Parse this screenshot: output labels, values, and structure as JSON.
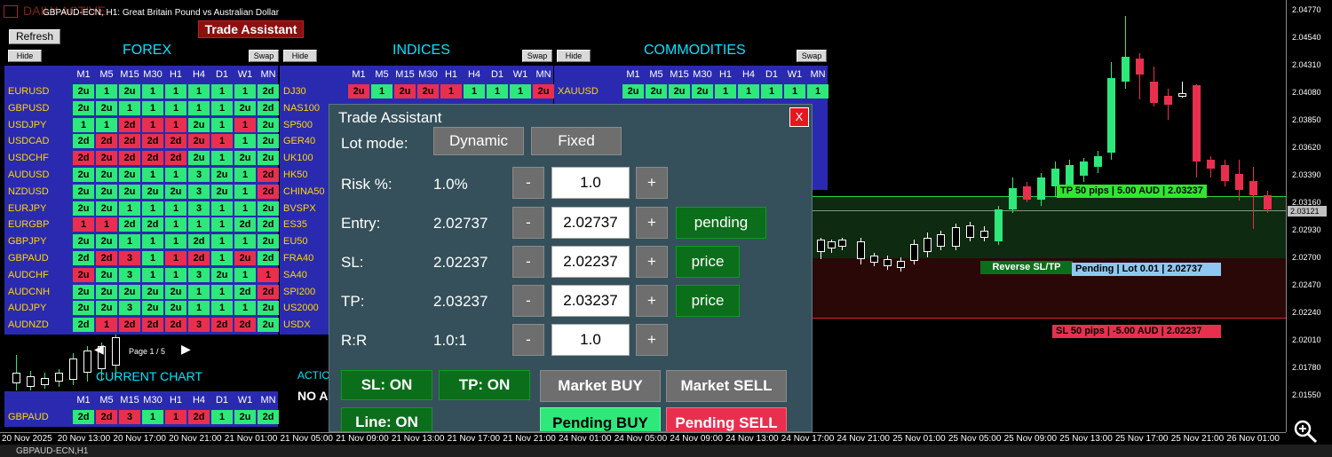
{
  "window": {
    "symbol_title": "GBPAUD-ECN, H1:  Great Britain Pound vs Australian Dollar",
    "ghost_text": "DAILY ACTIVE"
  },
  "toolbar": {
    "refresh": "Refresh",
    "badge": "Trade Assistant"
  },
  "sections": {
    "forex": "FOREX",
    "indices": "INDICES",
    "commodities": "COMMODITIES",
    "current_chart": "CURRENT CHART",
    "action": "ACTIO",
    "no_action": "NO A"
  },
  "hide_label": "Hide",
  "swap_label": "Swap",
  "timeframes": [
    "M1",
    "M5",
    "M15",
    "M30",
    "H1",
    "H4",
    "D1",
    "W1",
    "MN"
  ],
  "forex_rows": [
    {
      "symbol": "EURUSD",
      "cells": [
        [
          "2u",
          "g"
        ],
        [
          "1",
          "g"
        ],
        [
          "2u",
          "g"
        ],
        [
          "1",
          "g"
        ],
        [
          "1",
          "g"
        ],
        [
          "1",
          "g"
        ],
        [
          "1",
          "g"
        ],
        [
          "1",
          "g"
        ],
        [
          "2d",
          "g"
        ]
      ]
    },
    {
      "symbol": "GBPUSD",
      "cells": [
        [
          "2u",
          "g"
        ],
        [
          "2u",
          "g"
        ],
        [
          "1",
          "g"
        ],
        [
          "1",
          "g"
        ],
        [
          "1",
          "g"
        ],
        [
          "1",
          "g"
        ],
        [
          "1",
          "g"
        ],
        [
          "2u",
          "g"
        ],
        [
          "2d",
          "g"
        ]
      ]
    },
    {
      "symbol": "USDJPY",
      "cells": [
        [
          "1",
          "g"
        ],
        [
          "1",
          "g"
        ],
        [
          "2d",
          "r"
        ],
        [
          "1",
          "r"
        ],
        [
          "1",
          "r"
        ],
        [
          "2u",
          "g"
        ],
        [
          "1",
          "g"
        ],
        [
          "1",
          "r"
        ],
        [
          "2u",
          "g"
        ]
      ]
    },
    {
      "symbol": "USDCAD",
      "cells": [
        [
          "2d",
          "g"
        ],
        [
          "2d",
          "r"
        ],
        [
          "2d",
          "r"
        ],
        [
          "2d",
          "r"
        ],
        [
          "2d",
          "r"
        ],
        [
          "2u",
          "r"
        ],
        [
          "1",
          "r"
        ],
        [
          "1",
          "g"
        ],
        [
          "2u",
          "g"
        ]
      ]
    },
    {
      "symbol": "USDCHF",
      "cells": [
        [
          "2d",
          "r"
        ],
        [
          "2u",
          "r"
        ],
        [
          "2d",
          "r"
        ],
        [
          "2d",
          "r"
        ],
        [
          "2d",
          "r"
        ],
        [
          "2u",
          "g"
        ],
        [
          "1",
          "g"
        ],
        [
          "2u",
          "g"
        ],
        [
          "2u",
          "g"
        ]
      ]
    },
    {
      "symbol": "AUDUSD",
      "cells": [
        [
          "2u",
          "g"
        ],
        [
          "2u",
          "g"
        ],
        [
          "2u",
          "g"
        ],
        [
          "1",
          "g"
        ],
        [
          "1",
          "g"
        ],
        [
          "3",
          "g"
        ],
        [
          "2u",
          "g"
        ],
        [
          "1",
          "g"
        ],
        [
          "2d",
          "r"
        ]
      ]
    },
    {
      "symbol": "NZDUSD",
      "cells": [
        [
          "2u",
          "g"
        ],
        [
          "2u",
          "g"
        ],
        [
          "2u",
          "g"
        ],
        [
          "2u",
          "g"
        ],
        [
          "2u",
          "g"
        ],
        [
          "3",
          "g"
        ],
        [
          "2u",
          "g"
        ],
        [
          "1",
          "g"
        ],
        [
          "2d",
          "r"
        ]
      ]
    },
    {
      "symbol": "EURJPY",
      "cells": [
        [
          "2u",
          "g"
        ],
        [
          "2u",
          "g"
        ],
        [
          "1",
          "g"
        ],
        [
          "1",
          "g"
        ],
        [
          "1",
          "g"
        ],
        [
          "3",
          "g"
        ],
        [
          "1",
          "g"
        ],
        [
          "1",
          "g"
        ],
        [
          "2u",
          "g"
        ]
      ]
    },
    {
      "symbol": "EURGBP",
      "cells": [
        [
          "1",
          "r"
        ],
        [
          "1",
          "r"
        ],
        [
          "2d",
          "g"
        ],
        [
          "2d",
          "g"
        ],
        [
          "1",
          "g"
        ],
        [
          "1",
          "g"
        ],
        [
          "1",
          "g"
        ],
        [
          "2d",
          "g"
        ],
        [
          "2d",
          "g"
        ]
      ]
    },
    {
      "symbol": "GBPJPY",
      "cells": [
        [
          "2u",
          "g"
        ],
        [
          "2u",
          "g"
        ],
        [
          "1",
          "g"
        ],
        [
          "1",
          "g"
        ],
        [
          "1",
          "g"
        ],
        [
          "2d",
          "g"
        ],
        [
          "1",
          "g"
        ],
        [
          "1",
          "g"
        ],
        [
          "2u",
          "g"
        ]
      ]
    },
    {
      "symbol": "GBPAUD",
      "cells": [
        [
          "2d",
          "g"
        ],
        [
          "2d",
          "r"
        ],
        [
          "3",
          "r"
        ],
        [
          "1",
          "g"
        ],
        [
          "1",
          "r"
        ],
        [
          "2d",
          "r"
        ],
        [
          "1",
          "g"
        ],
        [
          "2u",
          "r"
        ],
        [
          "2d",
          "g"
        ]
      ]
    },
    {
      "symbol": "AUDCHF",
      "cells": [
        [
          "2u",
          "r"
        ],
        [
          "2u",
          "g"
        ],
        [
          "3",
          "g"
        ],
        [
          "1",
          "g"
        ],
        [
          "1",
          "g"
        ],
        [
          "3",
          "g"
        ],
        [
          "2u",
          "g"
        ],
        [
          "1",
          "g"
        ],
        [
          "1",
          "r"
        ]
      ]
    },
    {
      "symbol": "AUDCNH",
      "cells": [
        [
          "2u",
          "g"
        ],
        [
          "2u",
          "g"
        ],
        [
          "2u",
          "g"
        ],
        [
          "2u",
          "g"
        ],
        [
          "2u",
          "g"
        ],
        [
          "1",
          "g"
        ],
        [
          "1",
          "g"
        ],
        [
          "2d",
          "g"
        ],
        [
          "2d",
          "r"
        ]
      ]
    },
    {
      "symbol": "AUDJPY",
      "cells": [
        [
          "2u",
          "g"
        ],
        [
          "2u",
          "g"
        ],
        [
          "3",
          "g"
        ],
        [
          "2u",
          "g"
        ],
        [
          "2u",
          "g"
        ],
        [
          "1",
          "g"
        ],
        [
          "1",
          "g"
        ],
        [
          "1",
          "g"
        ],
        [
          "2u",
          "g"
        ]
      ]
    },
    {
      "symbol": "AUDNZD",
      "cells": [
        [
          "2d",
          "g"
        ],
        [
          "1",
          "r"
        ],
        [
          "2d",
          "r"
        ],
        [
          "2d",
          "r"
        ],
        [
          "2d",
          "r"
        ],
        [
          "3",
          "r"
        ],
        [
          "2d",
          "r"
        ],
        [
          "2d",
          "r"
        ],
        [
          "2u",
          "g"
        ]
      ]
    }
  ],
  "indices_rows": [
    {
      "symbol": "DJ30",
      "cells": [
        [
          "2u",
          "r"
        ],
        [
          "1",
          "g"
        ],
        [
          "2u",
          "r"
        ],
        [
          "2u",
          "r"
        ],
        [
          "1",
          "r"
        ],
        [
          "1",
          "g"
        ],
        [
          "1",
          "g"
        ],
        [
          "1",
          "g"
        ],
        [
          "2u",
          "r"
        ]
      ]
    },
    {
      "symbol": "NAS100"
    },
    {
      "symbol": "SP500"
    },
    {
      "symbol": "GER40"
    },
    {
      "symbol": "UK100"
    },
    {
      "symbol": "HK50"
    },
    {
      "symbol": "CHINA50"
    },
    {
      "symbol": "BVSPX"
    },
    {
      "symbol": "ES35"
    },
    {
      "symbol": "EU50"
    },
    {
      "symbol": "FRA40"
    },
    {
      "symbol": "SA40"
    },
    {
      "symbol": "SPI200"
    },
    {
      "symbol": "US2000"
    },
    {
      "symbol": "USDX"
    }
  ],
  "commodities_rows": [
    {
      "symbol": "XAUUSD",
      "cells": [
        [
          "2u",
          "g"
        ],
        [
          "2u",
          "g"
        ],
        [
          "2u",
          "g"
        ],
        [
          "2u",
          "g"
        ],
        [
          "1",
          "g"
        ],
        [
          "1",
          "g"
        ],
        [
          "1",
          "g"
        ],
        [
          "1",
          "g"
        ],
        [
          "1",
          "g"
        ]
      ]
    }
  ],
  "current_chart_row": {
    "symbol": "GBPAUD",
    "cells": [
      [
        "2d",
        "g"
      ],
      [
        "2d",
        "r"
      ],
      [
        "3",
        "r"
      ],
      [
        "1",
        "g"
      ],
      [
        "1",
        "r"
      ],
      [
        "2d",
        "r"
      ],
      [
        "1",
        "g"
      ],
      [
        "2u",
        "g"
      ],
      [
        "2d",
        "g"
      ]
    ]
  },
  "pager": {
    "label": "Page 1 / 5",
    "prev": "◀",
    "next": "▶"
  },
  "dialog": {
    "title": "Trade Assistant",
    "close": "X",
    "lot_mode_label": "Lot mode:",
    "lot_dynamic": "Dynamic",
    "lot_fixed": "Fixed",
    "risk_label": "Risk %:",
    "risk_value": "1.0%",
    "risk_input": "1.0",
    "entry_label": "Entry:",
    "entry_value": "2.02737",
    "entry_input": "2.02737",
    "entry_btn": "pending",
    "sl_label": "SL:",
    "sl_value": "2.02237",
    "sl_input": "2.02237",
    "sl_btn": "price",
    "tp_label": "TP:",
    "tp_value": "2.03237",
    "tp_input": "2.03237",
    "tp_btn": "price",
    "rr_label": "R:R",
    "rr_value": "1.0:1",
    "rr_input": "1.0",
    "minus": "-",
    "plus": "+",
    "sl_on": "SL: ON",
    "tp_on": "TP: ON",
    "line_on": "Line: ON",
    "market_buy": "Market BUY",
    "market_sell": "Market SELL",
    "pending_buy": "Pending BUY",
    "pending_sell": "Pending SELL"
  },
  "chart_labels": {
    "tp": "TP 50 pips | 5.00 AUD | 2.03237",
    "reverse": "Reverse SL/TP",
    "pending": "Pending | Lot 0.01 | 2.02737",
    "sl": "SL 50 pips | -5.00 AUD | 2.02237",
    "current_price": "2.03121"
  },
  "price_axis": [
    "2.04770",
    "2.04540",
    "2.04310",
    "2.04080",
    "2.03850",
    "2.03620",
    "2.03390",
    "2.03160",
    "2.02930",
    "2.02700",
    "2.02470",
    "2.02240",
    "2.02010",
    "2.01780",
    "2.01550"
  ],
  "time_axis": [
    "20 Nov 2025",
    "20 Nov 13:00",
    "20 Nov 17:00",
    "20 Nov 21:00",
    "21 Nov 01:00",
    "21 Nov 05:00",
    "21 Nov 09:00",
    "21 Nov 13:00",
    "21 Nov 17:00",
    "21 Nov 21:00",
    "24 Nov 01:00",
    "24 Nov 05:00",
    "24 Nov 09:00",
    "24 Nov 13:00",
    "24 Nov 17:00",
    "24 Nov 21:00",
    "25 Nov 01:00",
    "25 Nov 05:00",
    "25 Nov 09:00",
    "25 Nov 13:00",
    "25 Nov 17:00",
    "25 Nov 21:00",
    "26 Nov 01:00"
  ],
  "tab": {
    "label": "GBPAUD-ECN,H1"
  },
  "colors": {
    "bull": "#2ee87a",
    "bear": "#e8304e",
    "panel": "#2a2ab0",
    "dialog": "#35505a",
    "accent": "#00e5ff"
  }
}
